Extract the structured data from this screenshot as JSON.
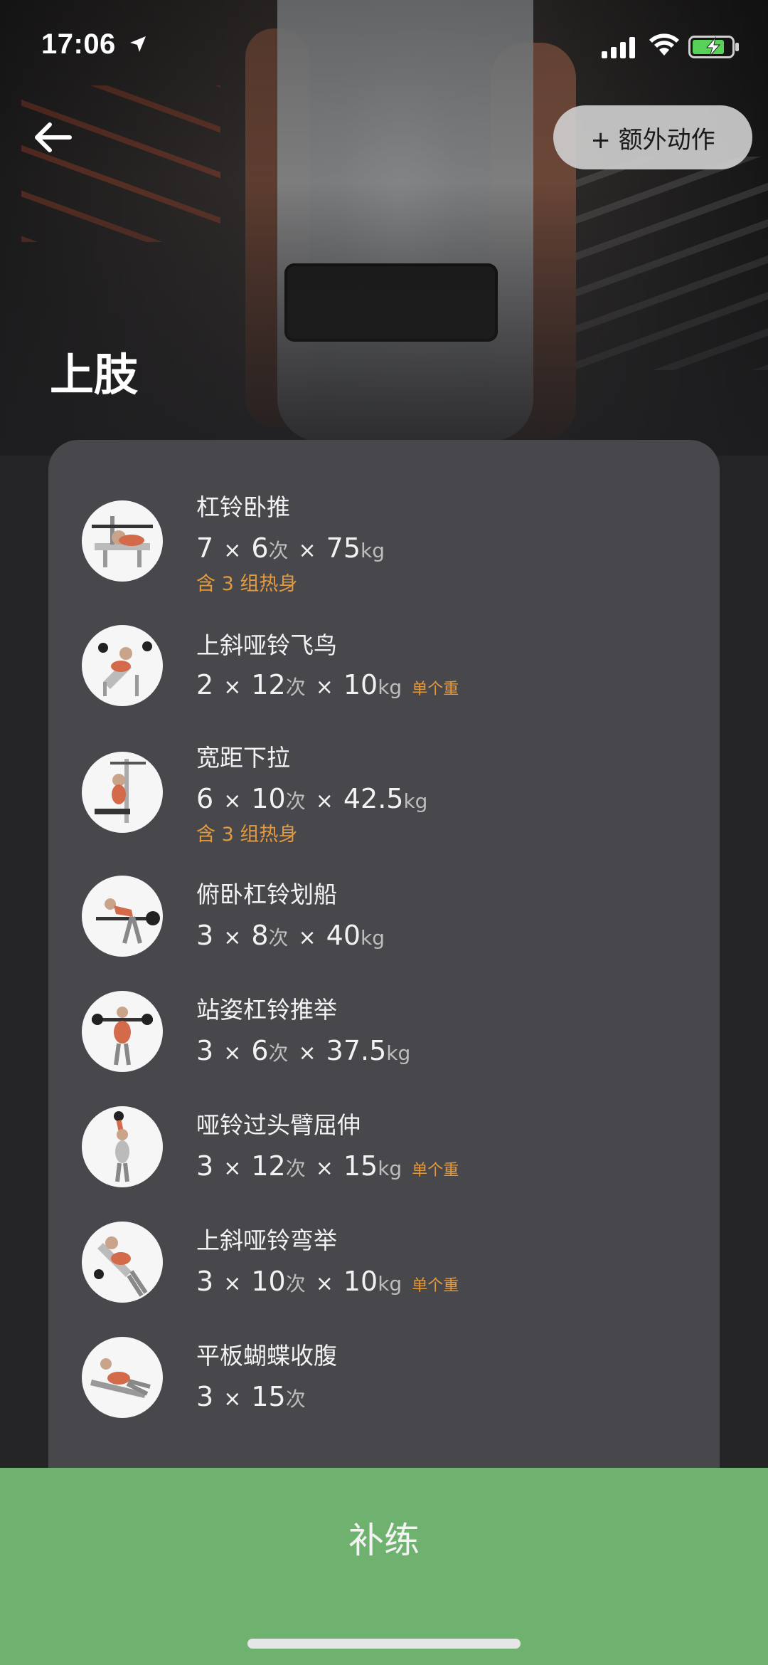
{
  "status_bar": {
    "time": "17:06"
  },
  "header": {
    "extra_button_label": "+ 额外动作",
    "title": "上肢"
  },
  "exercises": [
    {
      "name": "杠铃卧推",
      "sets": "7",
      "reps": "6",
      "reps_unit": "次",
      "weight": "75",
      "weight_unit": "kg",
      "note": "含 3 组热身",
      "single_label": ""
    },
    {
      "name": "上斜哑铃飞鸟",
      "sets": "2",
      "reps": "12",
      "reps_unit": "次",
      "weight": "10",
      "weight_unit": "kg",
      "note": "",
      "single_label": "单个重"
    },
    {
      "name": "宽距下拉",
      "sets": "6",
      "reps": "10",
      "reps_unit": "次",
      "weight": "42.5",
      "weight_unit": "kg",
      "note": "含 3 组热身",
      "single_label": ""
    },
    {
      "name": "俯卧杠铃划船",
      "sets": "3",
      "reps": "8",
      "reps_unit": "次",
      "weight": "40",
      "weight_unit": "kg",
      "note": "",
      "single_label": ""
    },
    {
      "name": "站姿杠铃推举",
      "sets": "3",
      "reps": "6",
      "reps_unit": "次",
      "weight": "37.5",
      "weight_unit": "kg",
      "note": "",
      "single_label": ""
    },
    {
      "name": "哑铃过头臂屈伸",
      "sets": "3",
      "reps": "12",
      "reps_unit": "次",
      "weight": "15",
      "weight_unit": "kg",
      "note": "",
      "single_label": "单个重"
    },
    {
      "name": "上斜哑铃弯举",
      "sets": "3",
      "reps": "10",
      "reps_unit": "次",
      "weight": "10",
      "weight_unit": "kg",
      "note": "",
      "single_label": "单个重"
    },
    {
      "name": "平板蝴蝶收腹",
      "sets": "3",
      "reps": "15",
      "reps_unit": "次",
      "weight": "",
      "weight_unit": "",
      "note": "",
      "single_label": ""
    }
  ],
  "times_symbol": "×",
  "bottom_button": {
    "label": "补练"
  },
  "colors": {
    "accent_orange": "#e29a3f",
    "button_green": "#6fb26f",
    "card_bg": "#48484c"
  }
}
